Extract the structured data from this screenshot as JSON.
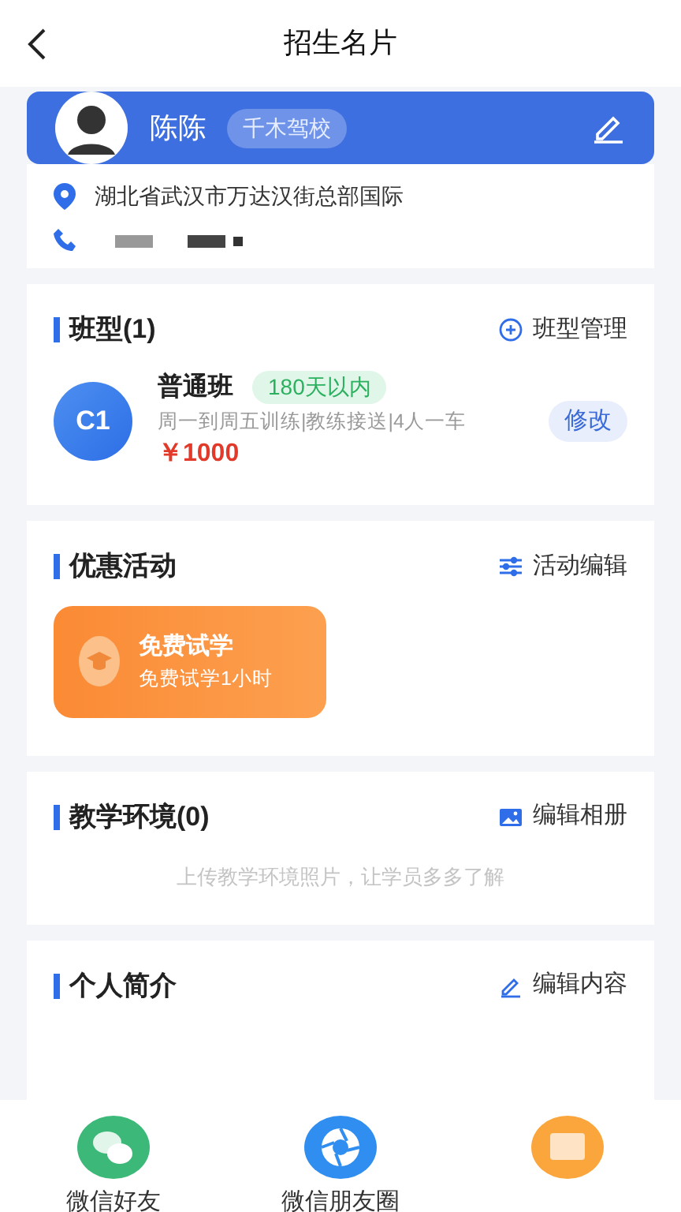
{
  "header": {
    "title": "招生名片"
  },
  "profile": {
    "name": "陈陈",
    "school": "千木驾校",
    "address": "湖北省武汉市万达汉街总部国际"
  },
  "sections": [
    {
      "kind": "classes",
      "title": "班型(1)",
      "action": {
        "label": "班型管理"
      },
      "items": [
        {
          "badge": "C1",
          "name": "普通班",
          "tag": "180天以内",
          "desc": "周一到周五训练|教练接送|4人一车",
          "price": "￥1000",
          "button": "修改"
        }
      ]
    },
    {
      "kind": "activities",
      "title": "优惠活动",
      "action": {
        "label": "活动编辑"
      },
      "items": [
        {
          "title": "免费试学",
          "subtitle": "免费试学1小时"
        }
      ]
    },
    {
      "kind": "gallery",
      "title": "教学环境(0)",
      "action": {
        "label": "编辑相册"
      },
      "empty": "上传教学环境照片，让学员多多了解"
    },
    {
      "kind": "intro",
      "title": "个人简介",
      "action": {
        "label": "编辑内容"
      }
    }
  ],
  "share": [
    {
      "kind": "wechat",
      "label": "微信好友"
    },
    {
      "kind": "moments",
      "label": "微信朋友圈"
    },
    {
      "kind": "photo"
    }
  ]
}
